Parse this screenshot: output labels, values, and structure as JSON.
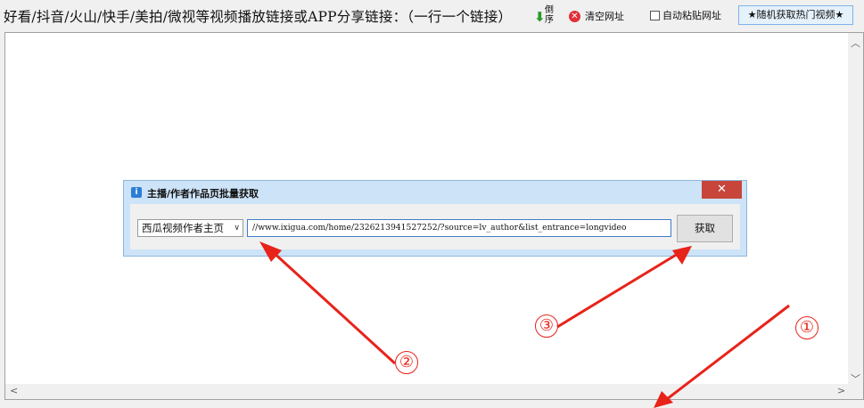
{
  "toolbar": {
    "instruction": "好看/抖音/火山/快手/美拍/微视等视频播放链接或APP分享链接：（一行一个链接）",
    "sort_label": "倒序",
    "clear_label": "清空网址",
    "autopaste_label": "自动粘贴网址",
    "autopaste_checked": false,
    "random_label": "★随机获取热门视频★"
  },
  "dialog": {
    "title": "主播/作者作品页批量获取",
    "close_label": "✕",
    "source_select": "西瓜视频作者主页",
    "url_value": "//www.ixigua.com/home/2326213941527252/?source=lv_author&list_entrance=longvideo",
    "fetch_label": "获取"
  },
  "annotations": {
    "marker_1": "①",
    "marker_2": "②",
    "marker_3": "③",
    "arrow_color": "#e8231a"
  },
  "icons": {
    "sort": "down-arrow-icon",
    "clear": "clear-circle-icon",
    "dialog": "info-icon"
  }
}
